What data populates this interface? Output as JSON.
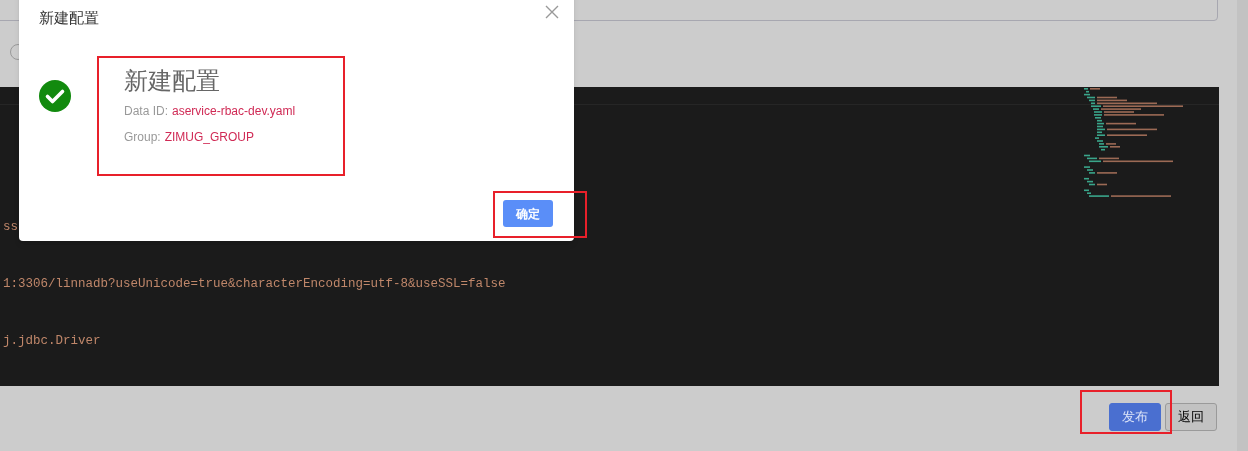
{
  "radio": {
    "selected": false
  },
  "editor": {
    "lines": [
      {
        "text": "ss"
      },
      {
        "text": "1:3306/linnadb?useUnicode=true&characterEncoding=utf-8&useSSL=false"
      },
      {
        "text": "j.jdbc.Driver"
      }
    ]
  },
  "footer": {
    "buttons": [
      {
        "label": "发布",
        "kind": "primary"
      },
      {
        "label": "返回",
        "kind": "default"
      }
    ]
  },
  "dialog": {
    "title": "新建配置",
    "heading": "新建配置",
    "fields": [
      {
        "label": "Data ID:",
        "value": "aservice-rbac-dev.yaml"
      },
      {
        "label": "Group:",
        "value": "ZIMUG_GROUP"
      }
    ],
    "confirm": "确定"
  }
}
